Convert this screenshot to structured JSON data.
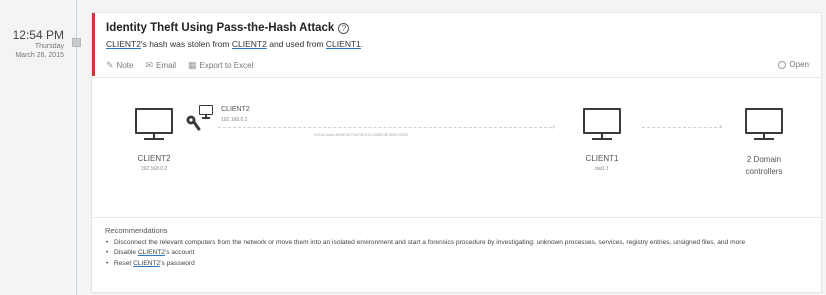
{
  "timeline": {
    "time": "12:54 PM",
    "day": "Thursday",
    "date": "March 26, 2015"
  },
  "alert": {
    "title": "Identity Theft Using Pass-the-Hash Attack",
    "help_icon": "?",
    "desc_entity_1": "CLIENT2",
    "desc_text_1": "'s hash was stolen from ",
    "desc_entity_2": "CLIENT2",
    "desc_text_2": " and used from ",
    "desc_entity_3": "CLIENT1",
    "desc_text_3": ".",
    "accent_color": "#d13438"
  },
  "actions": [
    {
      "icon": "pencil-icon",
      "label": "Note"
    },
    {
      "icon": "email-icon",
      "label": "Email"
    },
    {
      "icon": "excel-icon",
      "label": "Export to Excel"
    }
  ],
  "status": {
    "label": "Open"
  },
  "diagram": {
    "attacker": {
      "name": "CLIENT2",
      "ip": "192.168.0.2"
    },
    "source": {
      "name": "CLIENT2",
      "ip": "192.168.0.2"
    },
    "hash_label": "NTLM hash:6B9E5C724F9D41C1369C4E5B9C0288",
    "target": {
      "name": "CLIENT1",
      "ip": "dat1.1"
    },
    "dc": {
      "line1": "2 Domain",
      "line2": "controllers"
    }
  },
  "recommendations": {
    "title": "Recommendations",
    "items": [
      {
        "text": "Disconnect the relevant computers from the network or move them into an isolated environment and start a forensics procedure by investigating: unknown processes, services, registry entries, unsigned files, and more"
      },
      {
        "prefix": "Disable ",
        "entity": "CLIENT2",
        "suffix": "'s account"
      },
      {
        "prefix": "Reset ",
        "entity": "CLIENT2",
        "suffix": "'s password"
      }
    ]
  }
}
